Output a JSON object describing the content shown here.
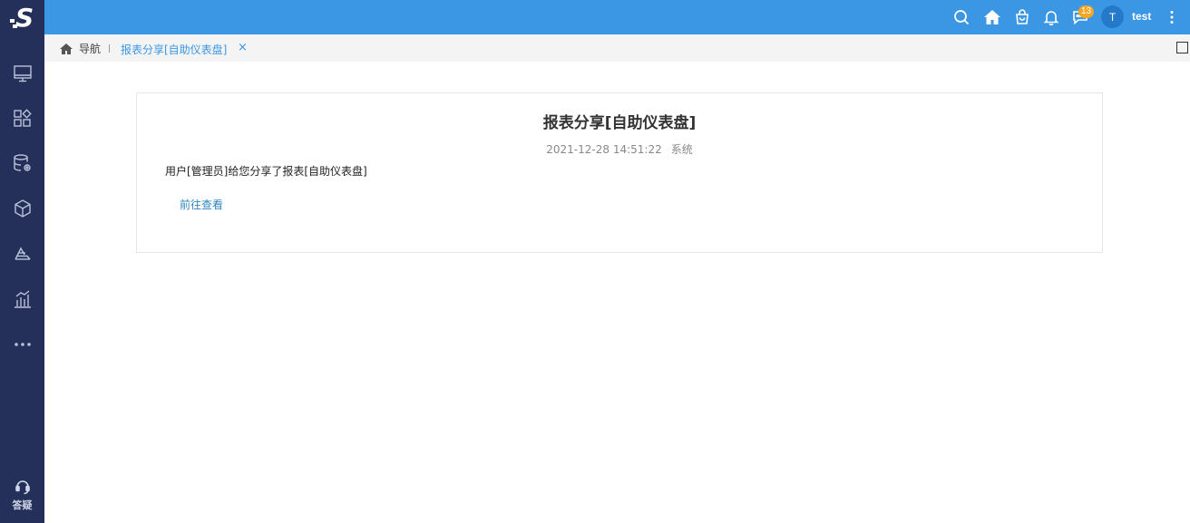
{
  "header": {
    "username": "test",
    "avatar_letter": "T",
    "message_count": "13",
    "icons": [
      "search-icon",
      "home-icon",
      "bag-icon",
      "bell-icon",
      "chat-icon",
      "more-vertical-icon"
    ]
  },
  "sidebar": {
    "items": [
      "monitor-icon",
      "apps-icon",
      "database-gear-icon",
      "cube-icon",
      "layers-icon",
      "bar-chart-icon",
      "more-icon"
    ],
    "help_label": "答疑"
  },
  "tabs": {
    "home_label": "导航",
    "active_label": "报表分享[自助仪表盘]",
    "close_glyph": "×"
  },
  "message": {
    "title": "报表分享[自助仪表盘]",
    "timestamp": "2021-12-28 14:51:22",
    "sender": "系统",
    "body": "用户[管理员]给您分享了报表[自助仪表盘]",
    "link_label": "前往查看"
  },
  "colors": {
    "header": "#3b96e4",
    "sidebar": "#24305a",
    "badge": "#f5a623",
    "link": "#2e86c1"
  }
}
